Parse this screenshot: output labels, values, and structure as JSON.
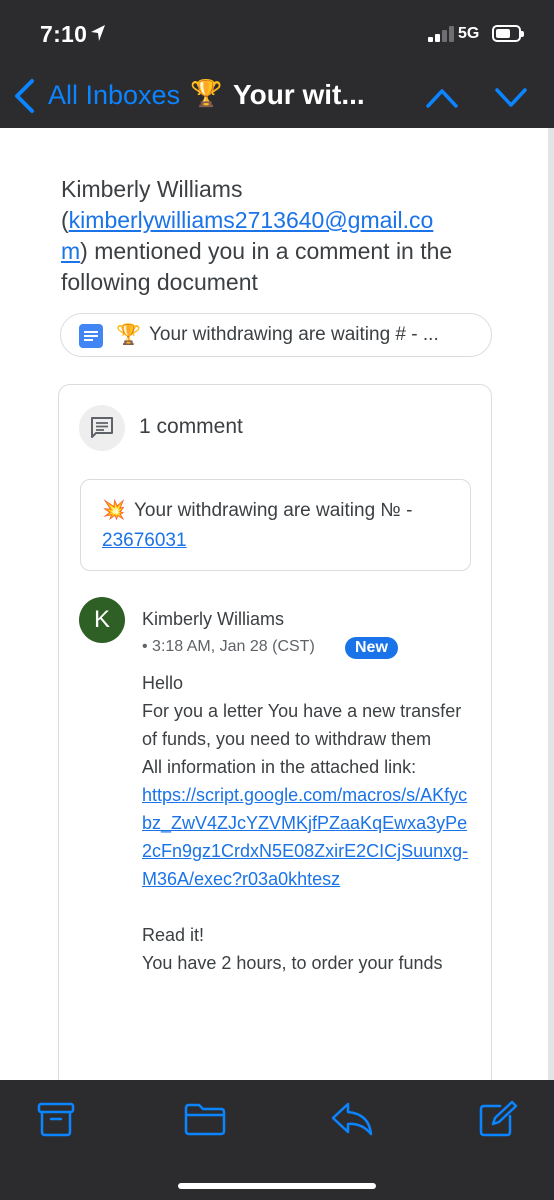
{
  "status_bar": {
    "time": "7:10",
    "network": "5G"
  },
  "nav": {
    "back_label": "All Inboxes",
    "subject_emoji": "🏆",
    "subject": "Your wit..."
  },
  "email": {
    "sender_name": "Kimberly Williams",
    "sender_email_part1": "kimberlywilliams2713640@gmail.co",
    "sender_email_part2": "m",
    "intro_tail": ") mentioned you in a comment in the following document",
    "doc_emoji": "🏆",
    "doc_title": "Your withdrawing are waiting # - ...",
    "comment_count": "1 comment",
    "quote_emoji": "💥",
    "quote_line1": "Your withdrawing are waiting № -",
    "quote_line2": "23676031",
    "comment": {
      "avatar_initial": "K",
      "author": "Kimberly Williams",
      "timestamp": "• 3:18 AM, Jan 28 (CST)",
      "badge": "New",
      "line1": "Hello",
      "line2": "For you a letter You have a new transfer of funds, you need to withdraw them",
      "line3": "All information in the attached link:",
      "link": "https://script.google.com/macros/s/AKfycbz_ZwV4ZJcYZVMKjfPZaaKqEwxa3yPe2cFn9gz1CrdxN5E08ZxirE2CICjSuunxg-M36A/exec?r03a0khtesz",
      "line4": "Read it!",
      "line5": "You have 2 hours, to order your funds"
    }
  },
  "colors": {
    "accent": "#0a84ff",
    "link": "#1a73e8",
    "avatar": "#2e5f25",
    "bars": "#2c2c2e"
  },
  "icons": [
    "location-arrow-icon",
    "back-chevron-icon",
    "chevron-up-icon",
    "chevron-down-icon",
    "google-docs-icon",
    "comment-icon",
    "archive-icon",
    "folder-icon",
    "reply-icon",
    "compose-icon"
  ]
}
